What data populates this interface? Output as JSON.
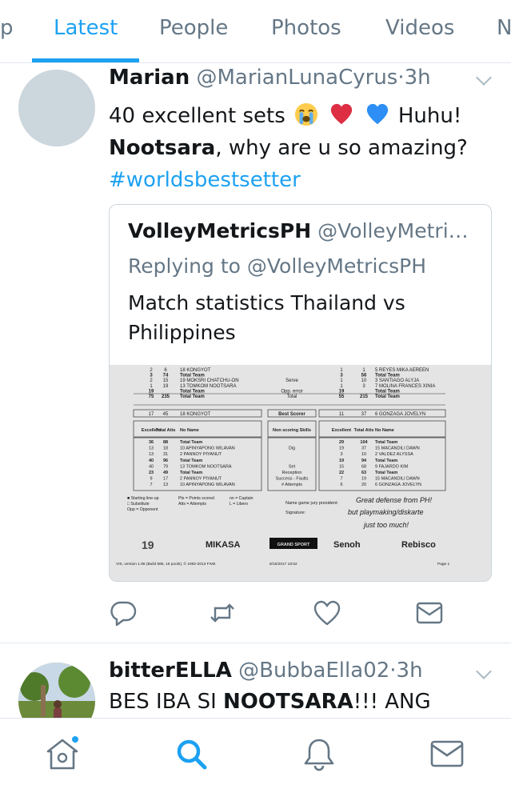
{
  "tabs": [
    {
      "label": "p",
      "active": false
    },
    {
      "label": "Latest",
      "active": true
    },
    {
      "label": "People",
      "active": false
    },
    {
      "label": "Photos",
      "active": false
    },
    {
      "label": "Videos",
      "active": false
    },
    {
      "label": "N",
      "active": false
    }
  ],
  "tweet1": {
    "name": "Marian",
    "handle": "@MarianLunaCyrus",
    "separator": "·",
    "time": "3h",
    "text_part1": "40 excellent sets",
    "emojis": [
      "crying-face",
      "red-heart",
      "blue-heart"
    ],
    "text_part2": "Huhu!",
    "bold_word": "Nootsara",
    "text_part3": ", why are u so amazing?",
    "hashtag": "#worldsbestsetter",
    "quote": {
      "name": "VolleyMetricsPH",
      "handle": "@VolleyMetri…",
      "replying": "Replying to @VolleyMetricsPH",
      "text": "Match statistics Thailand vs Philippines",
      "image": {
        "rows_top": [
          [
            "2",
            "6",
            "18 KONGYOT",
            "",
            "1",
            "1",
            "5 REYES MIKA AEREEN"
          ],
          [
            "3",
            "74",
            "Total Team",
            "",
            "3",
            "56",
            "Total Team"
          ],
          [
            "2",
            "15",
            "19 MOKSRI CHATCHU-ON",
            "Serve",
            "1",
            "10",
            "3 SANTIAGO ALYJA"
          ],
          [
            "1",
            "19",
            "13 TOMKOM NOOTSARA",
            "",
            "1",
            "3",
            "7 MOLINA FRANCES XINIA"
          ],
          [
            "19",
            "",
            "Total Team",
            "Opp. error",
            "19",
            "",
            "Total Team"
          ],
          [
            "75",
            "235",
            "Total Team",
            "Total",
            "55",
            "215",
            "Total Team"
          ]
        ],
        "best_scorer": [
          "17",
          "45",
          "18 KONGYOT",
          "Best Scorer",
          "11",
          "37",
          "6 GONZAGA JOVELYN"
        ],
        "header_row": [
          "Excellent",
          "Total Atts",
          "No Name",
          "Non scoring Skills",
          "Excellent",
          "Total Atts",
          "No Name"
        ],
        "rows_bottom": [
          [
            "36",
            "88",
            "Total Team",
            "",
            "29",
            "104",
            "Total Team"
          ],
          [
            "13",
            "18",
            "10 APINYAPONG WILAVAN",
            "Dig",
            "19",
            "37",
            "15 MACANDILI DAWN"
          ],
          [
            "13",
            "31",
            "2 PANNOY PIYANUT",
            "",
            "3",
            "10",
            "2 VALDEZ ALYSSA"
          ],
          [
            "40",
            "96",
            "Total Team",
            "",
            "19",
            "94",
            "Total Team"
          ],
          [
            "40",
            "79",
            "13 TOMKOM NOOTSARA",
            "Set",
            "15",
            "68",
            "9 FAJARDO KIM"
          ],
          [
            "23",
            "49",
            "Total Team",
            "Reception",
            "22",
            "63",
            "Total Team"
          ],
          [
            "9",
            "17",
            "2 PANNOY PIYANUT",
            "Success - Faults",
            "7",
            "19",
            "15 MACANDILI DAWN"
          ],
          [
            "7",
            "13",
            "10 APINYAPONG WILAVAN",
            "# Attempts",
            "6",
            "20",
            "6 GONZAGA JOVELYN"
          ]
        ],
        "legend": [
          "Starting line-up",
          "Pts = Points scored",
          "nn = Captain",
          "Substitute",
          "Atts = Attempts",
          "L = Libero",
          "Opp = Opponent"
        ],
        "jury_label": "Name game jury president:",
        "signature_label": "Signature:",
        "handwriting": [
          "Great defense from PH!",
          "but playmaking/diskarte",
          "just too much!"
        ],
        "sponsors": [
          "19",
          "MIKASA",
          "GRAND SPORT",
          "Senoh",
          "Rebisco"
        ],
        "footer_left": "VIS, version 1.96 (Build 585, 16 pools), © 1992-2013 FIVB",
        "footer_mid": "8/15/2017 18:52",
        "footer_right": "Page 1"
      }
    },
    "actions": [
      "reply-icon",
      "retweet-icon",
      "like-icon",
      "message-icon"
    ]
  },
  "tweet2": {
    "name": "bitterELLA",
    "handle": "@BubbaElla02",
    "separator": "·",
    "time": "3h",
    "text_part1": "BES IBA SI ",
    "bold_word": "NOOTSARA",
    "text_part2": "!!! ANG"
  },
  "bottom_nav": [
    {
      "icon": "home-icon",
      "active": false,
      "badge": true
    },
    {
      "icon": "search-icon",
      "active": true
    },
    {
      "icon": "notifications-icon",
      "active": false
    },
    {
      "icon": "messages-icon",
      "active": false
    }
  ],
  "colors": {
    "accent": "#1da1f2",
    "muted": "#657786",
    "border": "#e1e8ed"
  }
}
